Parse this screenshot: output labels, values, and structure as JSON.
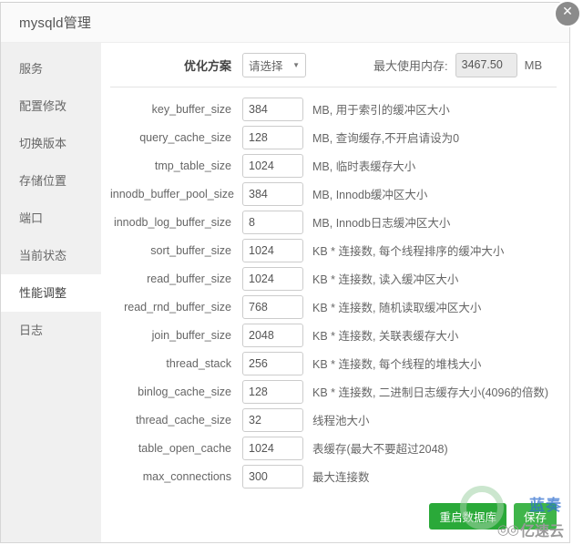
{
  "window": {
    "title": "mysqld管理",
    "close_icon": "close-icon"
  },
  "sidebar": {
    "items": [
      {
        "label": "服务",
        "active": false
      },
      {
        "label": "配置修改",
        "active": false
      },
      {
        "label": "切换版本",
        "active": false
      },
      {
        "label": "存储位置",
        "active": false
      },
      {
        "label": "端口",
        "active": false
      },
      {
        "label": "当前状态",
        "active": false
      },
      {
        "label": "性能调整",
        "active": true
      },
      {
        "label": "日志",
        "active": false
      }
    ]
  },
  "top": {
    "scheme_label": "优化方案",
    "scheme_value": "请选择",
    "scheme_caret": "chevron-down-icon",
    "memory_label": "最大使用内存:",
    "memory_value": "3467.50",
    "memory_unit": "MB"
  },
  "params": [
    {
      "name": "key_buffer_size",
      "value": "384",
      "hint": "MB, 用于索引的缓冲区大小"
    },
    {
      "name": "query_cache_size",
      "value": "128",
      "hint": "MB, 查询缓存,不开启请设为0"
    },
    {
      "name": "tmp_table_size",
      "value": "1024",
      "hint": "MB, 临时表缓存大小"
    },
    {
      "name": "innodb_buffer_pool_size",
      "value": "384",
      "hint": "MB, Innodb缓冲区大小"
    },
    {
      "name": "innodb_log_buffer_size",
      "value": "8",
      "hint": "MB, Innodb日志缓冲区大小"
    },
    {
      "name": "sort_buffer_size",
      "value": "1024",
      "hint": "KB * 连接数, 每个线程排序的缓冲大小"
    },
    {
      "name": "read_buffer_size",
      "value": "1024",
      "hint": "KB * 连接数, 读入缓冲区大小"
    },
    {
      "name": "read_rnd_buffer_size",
      "value": "768",
      "hint": "KB * 连接数, 随机读取缓冲区大小"
    },
    {
      "name": "join_buffer_size",
      "value": "2048",
      "hint": "KB * 连接数, 关联表缓存大小"
    },
    {
      "name": "thread_stack",
      "value": "256",
      "hint": "KB * 连接数, 每个线程的堆栈大小"
    },
    {
      "name": "binlog_cache_size",
      "value": "128",
      "hint": "KB * 连接数, 二进制日志缓存大小(4096的倍数)"
    },
    {
      "name": "thread_cache_size",
      "value": "32",
      "hint": "线程池大小"
    },
    {
      "name": "table_open_cache",
      "value": "1024",
      "hint": "表缓存(最大不要超过2048)"
    },
    {
      "name": "max_connections",
      "value": "300",
      "hint": "最大连接数"
    }
  ],
  "buttons": {
    "restart": "重启数据库",
    "save": "保存"
  },
  "watermarks": {
    "blue_text": "蓝奏",
    "bottom_glyph": "◎◎",
    "bottom_text": "亿速云"
  },
  "colors": {
    "accent_green": "#2aa939",
    "sidebar_bg": "#f0f0f0",
    "title_bg": "#fafafa"
  }
}
